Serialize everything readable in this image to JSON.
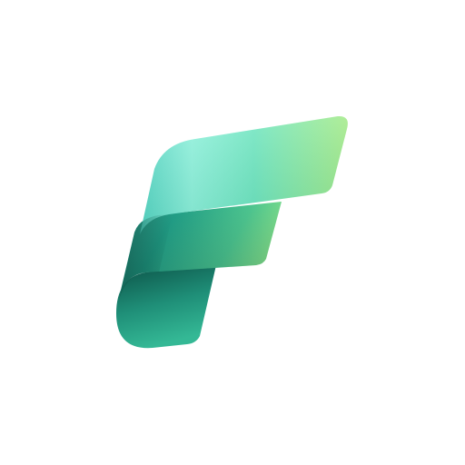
{
  "logo": {
    "name": "fabric-logo-icon",
    "colors": {
      "top_band_start": "#5fd8c4",
      "top_band_highlight": "#8df0d8",
      "top_band_end": "#9ae88a",
      "middle_band_start": "#2a8f80",
      "middle_band_end": "#86e08a",
      "stem_start": "#0e5a4e",
      "stem_end": "#2fb08e"
    }
  }
}
